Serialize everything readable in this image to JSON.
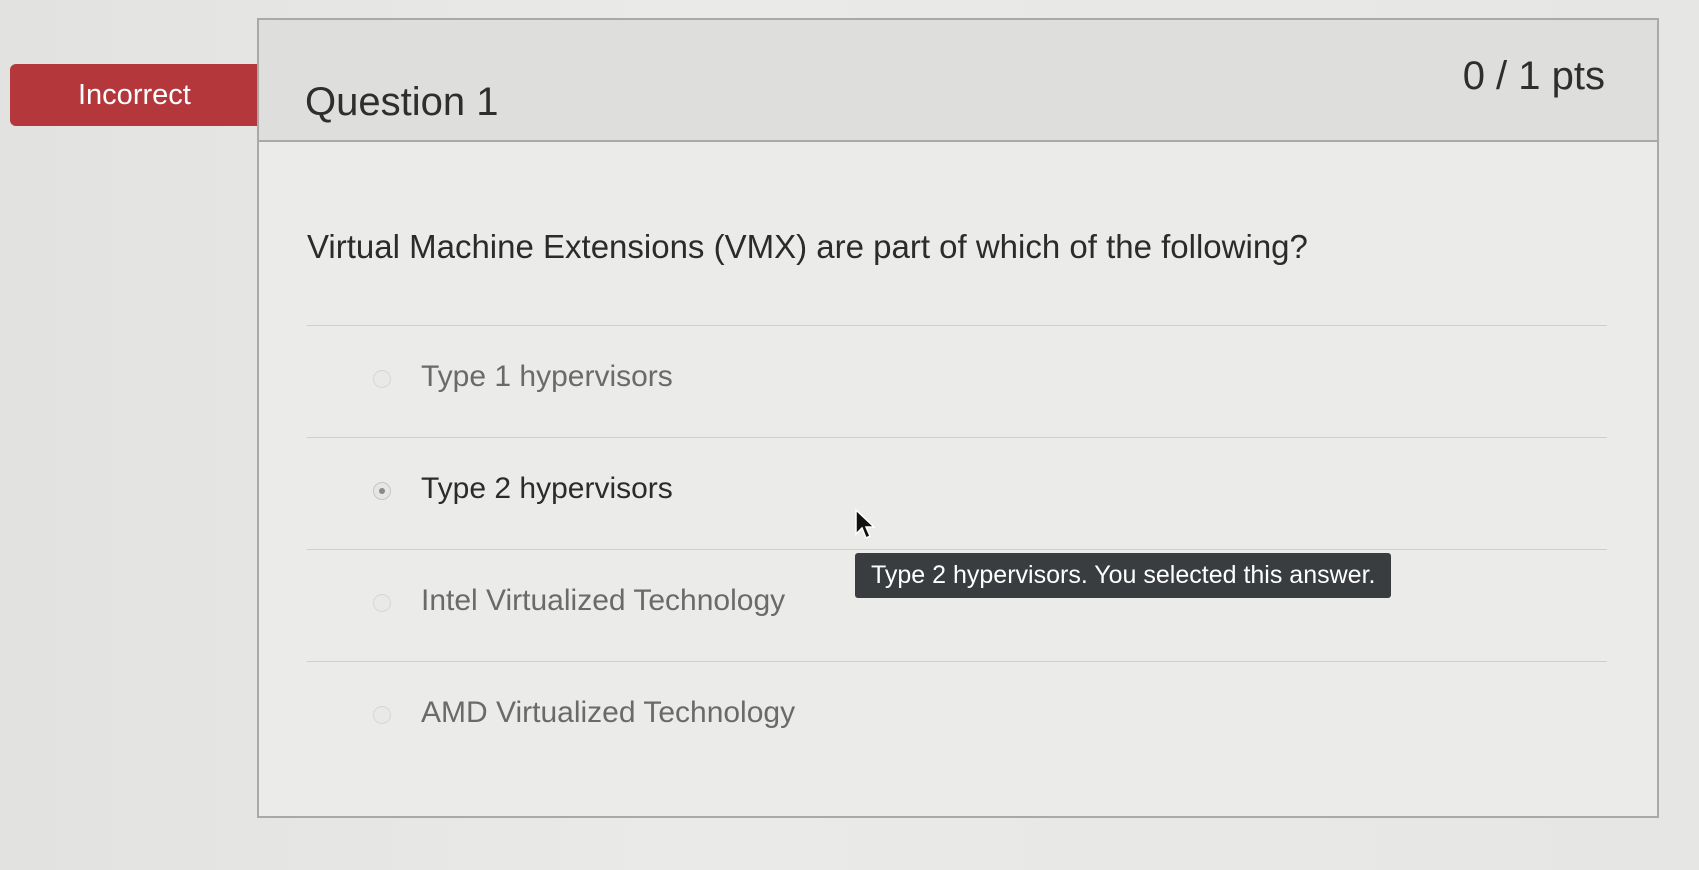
{
  "status": {
    "label": "Incorrect",
    "color": "#b4373c"
  },
  "question": {
    "title": "Question 1",
    "points": "0 / 1 pts",
    "text": "Virtual Machine Extensions (VMX) are part of which of the following?"
  },
  "answers": [
    {
      "label": "Type 1 hypervisors",
      "selected": false
    },
    {
      "label": "Type 2 hypervisors",
      "selected": true
    },
    {
      "label": "Intel Virtualized Technology",
      "selected": false
    },
    {
      "label": "AMD Virtualized Technology",
      "selected": false
    }
  ],
  "tooltip": {
    "text": "Type 2 hypervisors. You selected this answer."
  },
  "icons": {
    "cursor": "mouse-pointer-icon"
  }
}
